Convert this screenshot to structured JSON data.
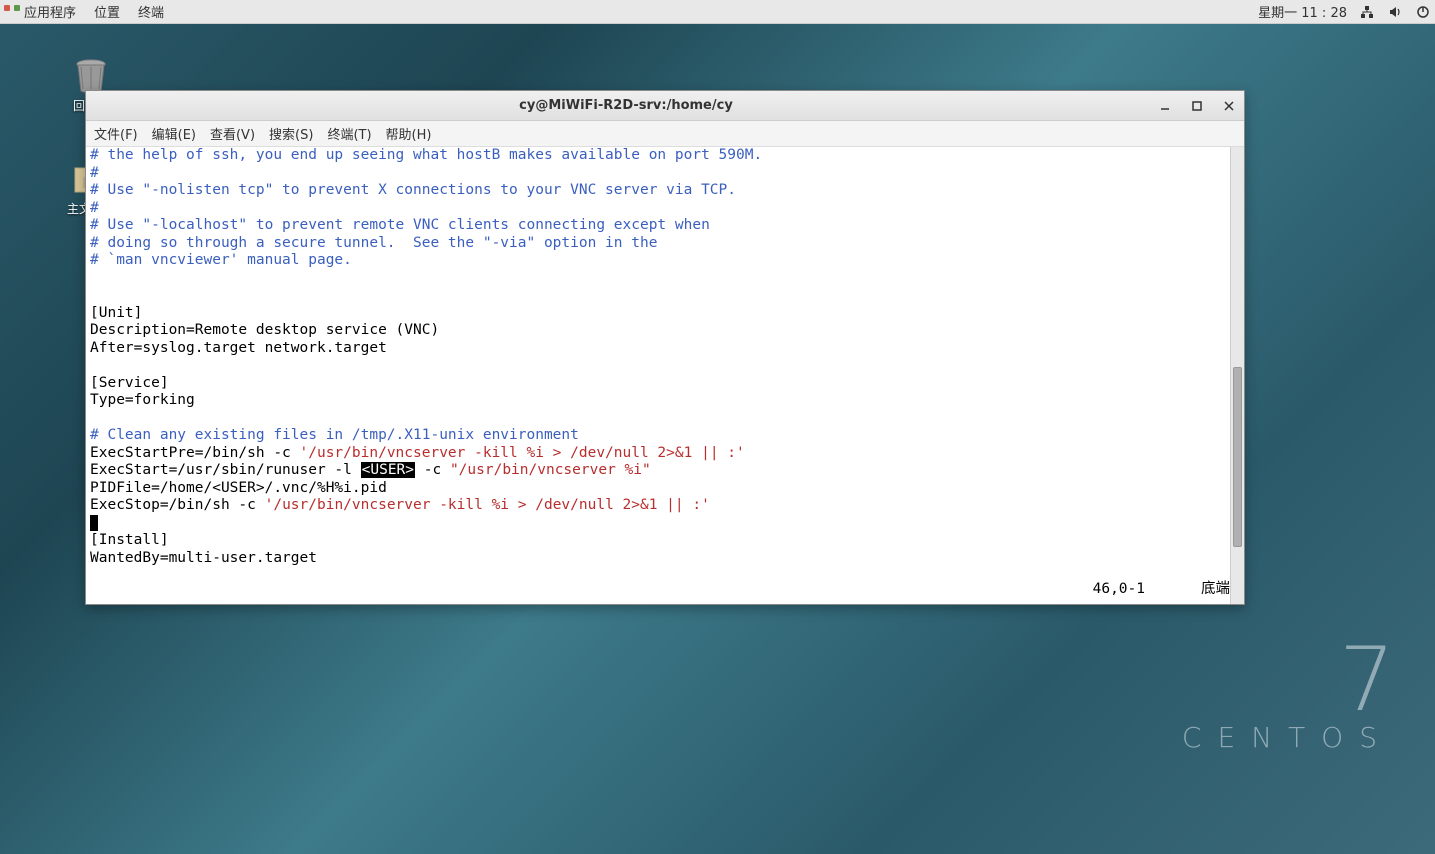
{
  "panel": {
    "apps": "应用程序",
    "places": "位置",
    "terminal": "终端",
    "clock": "星期一  11 : 28"
  },
  "desktop": {
    "trash_label": "回收站",
    "home_label": "主文件夹"
  },
  "brand": {
    "num": "7",
    "name": "CENTOS"
  },
  "window": {
    "title": "cy@MiWiFi-R2D-srv:/home/cy",
    "menu": {
      "file": "文件(F)",
      "edit": "编辑(E)",
      "view": "查看(V)",
      "search": "搜索(S)",
      "terminal": "终端(T)",
      "help": "帮助(H)"
    }
  },
  "term": {
    "l01": "# the help of ssh, you end up seeing what hostB makes available on port 590M.",
    "l02": "#",
    "l03": "# Use \"-nolisten tcp\" to prevent X connections to your VNC server via TCP.",
    "l04": "#",
    "l05": "# Use \"-localhost\" to prevent remote VNC clients connecting except when",
    "l06": "# doing so through a secure tunnel.  See the \"-via\" option in the",
    "l07": "# `man vncviewer' manual page.",
    "l10": "[Unit]",
    "l11": "Description=Remote desktop service (VNC)",
    "l12": "After=syslog.target network.target",
    "l14": "[Service]",
    "l15": "Type=forking",
    "l17": "# Clean any existing files in /tmp/.X11-unix environment",
    "l18a": "ExecStartPre=/bin/sh -c ",
    "l18b": "'/usr/bin/vncserver -kill %i > /dev/null 2>&1 || :'",
    "l19a": "ExecStart=/usr/sbin/runuser -l ",
    "l19u": "<USER>",
    "l19b": " -c ",
    "l19c": "\"/usr/bin/vncserver %i\"",
    "l20": "PIDFile=/home/<USER>/.vnc/%H%i.pid",
    "l21a": "ExecStop=/bin/sh -c ",
    "l21b": "'/usr/bin/vncserver -kill %i > /dev/null 2>&1 || :'",
    "l23": "[Install]",
    "l24": "WantedBy=multi-user.target",
    "pos": "46,0-1",
    "mode": "底端"
  }
}
